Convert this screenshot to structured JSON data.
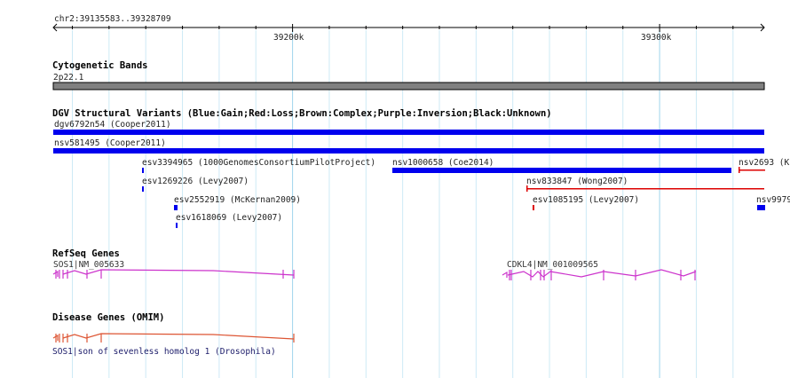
{
  "ruler": {
    "location": "chr2:39135583..39328709",
    "ticks": [
      "39200k",
      "39300k"
    ]
  },
  "tracks": {
    "cytoband": {
      "title": "Cytogenetic Bands",
      "band": "2p22.1",
      "color": "#808080"
    },
    "dgv": {
      "title": "DGV Structural Variants (Blue:Gain;Red:Loss;Brown:Complex;Purple:Inversion;Black:Unknown)",
      "colors": {
        "gain": "#0000ee",
        "loss": "#dd0000"
      },
      "features": [
        {
          "label": "dgv6792n54 (Cooper2011)",
          "type": "gain"
        },
        {
          "label": "nsv581495 (Cooper2011)",
          "type": "gain"
        },
        {
          "label": "esv3394965 (1000GenomesConsortiumPilotProject)",
          "type": "gain"
        },
        {
          "label": "nsv1000658 (Coe2014)",
          "type": "gain"
        },
        {
          "label": "nsv2693 (K",
          "type": "loss"
        },
        {
          "label": "esv1269226 (Levy2007)",
          "type": "gain"
        },
        {
          "label": "nsv833847 (Wong2007)",
          "type": "loss"
        },
        {
          "label": "esv2552919 (McKernan2009)",
          "type": "gain"
        },
        {
          "label": "esv1085195 (Levy2007)",
          "type": "loss"
        },
        {
          "label": "nsv9979",
          "type": "gain"
        },
        {
          "label": "esv1618069 (Levy2007)",
          "type": "gain"
        }
      ]
    },
    "refseq": {
      "title": "RefSeq Genes",
      "color": "#cc33cc",
      "genes": [
        {
          "label": "SOS1|NM_005633"
        },
        {
          "label": "CDKL4|NM_001009565"
        }
      ]
    },
    "omim": {
      "title": "Disease Genes (OMIM)",
      "color": "#dd5533",
      "genes": [
        {
          "label": "SOS1|son of sevenless homolog 1 (Drosophila)"
        }
      ]
    }
  }
}
